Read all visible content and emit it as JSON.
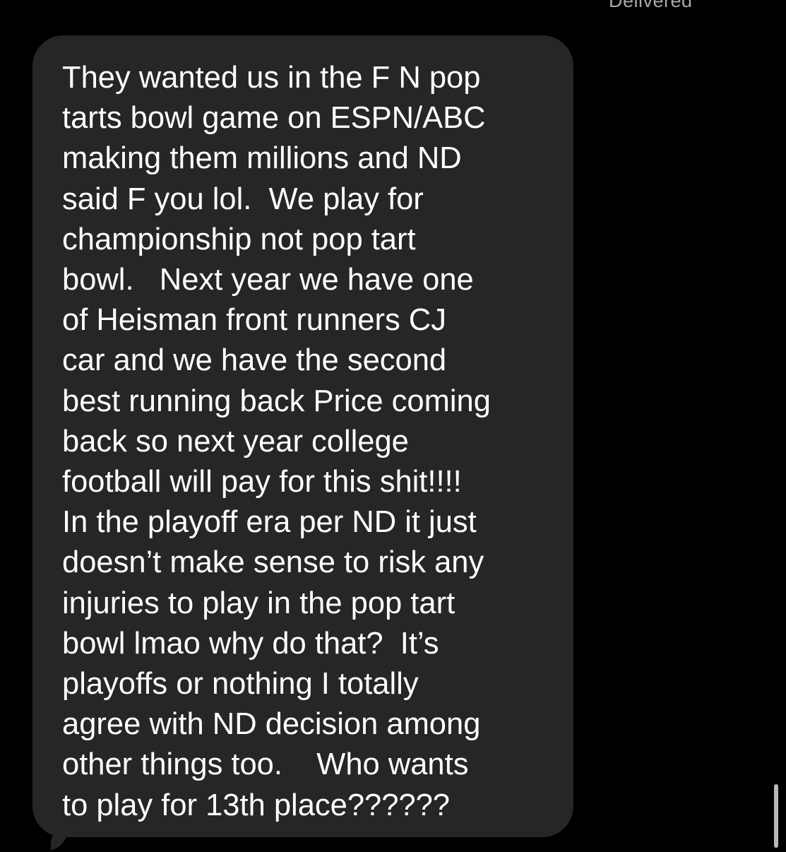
{
  "status": {
    "delivered_label": "Delivered"
  },
  "message": {
    "lines": [
      "They wanted us in the F N pop",
      "tarts bowl game on ESPN/ABC",
      "making them millions and ND",
      "said F you lol.  We play for",
      "championship not pop tart",
      "bowl.   Next year we have one",
      "of Heisman front runners CJ",
      "car and we have the second",
      "best running back Price coming",
      "back so next year college",
      "football will pay for this shit!!!!",
      "In the playoff era per ND it just",
      "doesn’t make sense to risk any",
      "injuries to play in the pop tart",
      "bowl lmao why do that?  It’s",
      "playoffs or nothing I totally",
      "agree with ND decision among",
      "other things too.    Who wants",
      "to play for 13th place??????"
    ]
  },
  "colors": {
    "background": "#000000",
    "bubble": "#262628",
    "text": "#ffffff",
    "status_text": "#a8a8ad"
  }
}
